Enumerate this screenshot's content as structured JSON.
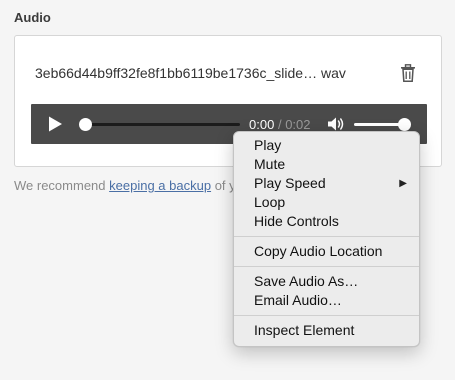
{
  "section": {
    "label": "Audio"
  },
  "file": {
    "name": "3eb66d44b9ff32fe8f1bb6119be1736c_slide…",
    "extension": "wav"
  },
  "player": {
    "current_time": "0:00",
    "separator": "/",
    "duration": "0:02",
    "progress": 0,
    "volume": 1.0
  },
  "hint": {
    "prefix": "We recommend",
    "link_text": "keeping a backup",
    "suffix": "of y"
  },
  "context_menu": {
    "play": "Play",
    "mute": "Mute",
    "play_speed": "Play Speed",
    "loop": "Loop",
    "hide_controls": "Hide Controls",
    "copy_audio_location": "Copy Audio Location",
    "save_audio_as": "Save Audio As…",
    "email_audio": "Email Audio…",
    "inspect_element": "Inspect Element"
  },
  "colors": {
    "player_bg": "#4a4a4a",
    "link": "#4a6fa5",
    "page_bg": "#f5f5f5"
  }
}
